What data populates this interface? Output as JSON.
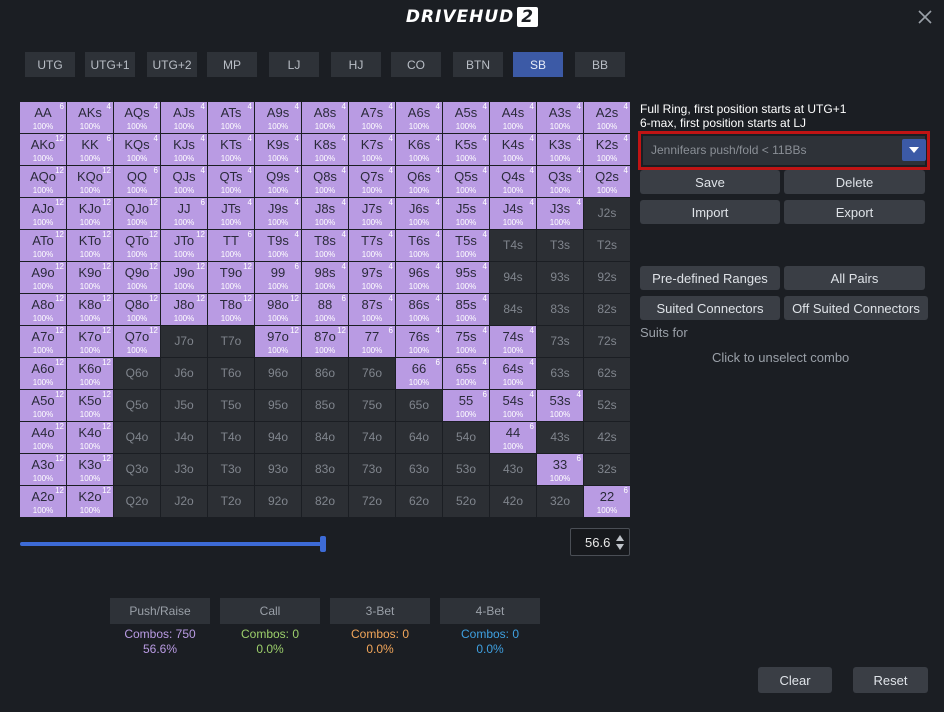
{
  "app": {
    "logo_text": "DRIVEHUD",
    "logo_version": "2"
  },
  "positions": [
    {
      "label": "UTG",
      "active": false
    },
    {
      "label": "UTG+1",
      "active": false
    },
    {
      "label": "UTG+2",
      "active": false
    },
    {
      "label": "MP",
      "active": false
    },
    {
      "label": "LJ",
      "active": false
    },
    {
      "label": "HJ",
      "active": false
    },
    {
      "label": "CO",
      "active": false
    },
    {
      "label": "BTN",
      "active": false
    },
    {
      "label": "SB",
      "active": true
    },
    {
      "label": "BB",
      "active": false
    }
  ],
  "grid": {
    "rows": [
      [
        {
          "h": "AA",
          "s": 1,
          "c": "6",
          "p": "100%"
        },
        {
          "h": "AKs",
          "s": 1,
          "c": "4",
          "p": "100%"
        },
        {
          "h": "AQs",
          "s": 1,
          "c": "4",
          "p": "100%"
        },
        {
          "h": "AJs",
          "s": 1,
          "c": "4",
          "p": "100%"
        },
        {
          "h": "ATs",
          "s": 1,
          "c": "4",
          "p": "100%"
        },
        {
          "h": "A9s",
          "s": 1,
          "c": "4",
          "p": "100%"
        },
        {
          "h": "A8s",
          "s": 1,
          "c": "4",
          "p": "100%"
        },
        {
          "h": "A7s",
          "s": 1,
          "c": "4",
          "p": "100%"
        },
        {
          "h": "A6s",
          "s": 1,
          "c": "4",
          "p": "100%"
        },
        {
          "h": "A5s",
          "s": 1,
          "c": "4",
          "p": "100%"
        },
        {
          "h": "A4s",
          "s": 1,
          "c": "4",
          "p": "100%"
        },
        {
          "h": "A3s",
          "s": 1,
          "c": "4",
          "p": "100%"
        },
        {
          "h": "A2s",
          "s": 1,
          "c": "4",
          "p": "100%"
        }
      ],
      [
        {
          "h": "AKo",
          "s": 1,
          "c": "12",
          "p": "100%"
        },
        {
          "h": "KK",
          "s": 1,
          "c": "6",
          "p": "100%"
        },
        {
          "h": "KQs",
          "s": 1,
          "c": "4",
          "p": "100%"
        },
        {
          "h": "KJs",
          "s": 1,
          "c": "4",
          "p": "100%"
        },
        {
          "h": "KTs",
          "s": 1,
          "c": "4",
          "p": "100%"
        },
        {
          "h": "K9s",
          "s": 1,
          "c": "4",
          "p": "100%"
        },
        {
          "h": "K8s",
          "s": 1,
          "c": "4",
          "p": "100%"
        },
        {
          "h": "K7s",
          "s": 1,
          "c": "4",
          "p": "100%"
        },
        {
          "h": "K6s",
          "s": 1,
          "c": "4",
          "p": "100%"
        },
        {
          "h": "K5s",
          "s": 1,
          "c": "4",
          "p": "100%"
        },
        {
          "h": "K4s",
          "s": 1,
          "c": "4",
          "p": "100%"
        },
        {
          "h": "K3s",
          "s": 1,
          "c": "4",
          "p": "100%"
        },
        {
          "h": "K2s",
          "s": 1,
          "c": "4",
          "p": "100%"
        }
      ],
      [
        {
          "h": "AQo",
          "s": 1,
          "c": "12",
          "p": "100%"
        },
        {
          "h": "KQo",
          "s": 1,
          "c": "12",
          "p": "100%"
        },
        {
          "h": "QQ",
          "s": 1,
          "c": "6",
          "p": "100%"
        },
        {
          "h": "QJs",
          "s": 1,
          "c": "4",
          "p": "100%"
        },
        {
          "h": "QTs",
          "s": 1,
          "c": "4",
          "p": "100%"
        },
        {
          "h": "Q9s",
          "s": 1,
          "c": "4",
          "p": "100%"
        },
        {
          "h": "Q8s",
          "s": 1,
          "c": "4",
          "p": "100%"
        },
        {
          "h": "Q7s",
          "s": 1,
          "c": "4",
          "p": "100%"
        },
        {
          "h": "Q6s",
          "s": 1,
          "c": "4",
          "p": "100%"
        },
        {
          "h": "Q5s",
          "s": 1,
          "c": "4",
          "p": "100%"
        },
        {
          "h": "Q4s",
          "s": 1,
          "c": "4",
          "p": "100%"
        },
        {
          "h": "Q3s",
          "s": 1,
          "c": "4",
          "p": "100%"
        },
        {
          "h": "Q2s",
          "s": 1,
          "c": "4",
          "p": "100%"
        }
      ],
      [
        {
          "h": "AJo",
          "s": 1,
          "c": "12",
          "p": "100%"
        },
        {
          "h": "KJo",
          "s": 1,
          "c": "12",
          "p": "100%"
        },
        {
          "h": "QJo",
          "s": 1,
          "c": "12",
          "p": "100%"
        },
        {
          "h": "JJ",
          "s": 1,
          "c": "6",
          "p": "100%"
        },
        {
          "h": "JTs",
          "s": 1,
          "c": "4",
          "p": "100%"
        },
        {
          "h": "J9s",
          "s": 1,
          "c": "4",
          "p": "100%"
        },
        {
          "h": "J8s",
          "s": 1,
          "c": "4",
          "p": "100%"
        },
        {
          "h": "J7s",
          "s": 1,
          "c": "4",
          "p": "100%"
        },
        {
          "h": "J6s",
          "s": 1,
          "c": "4",
          "p": "100%"
        },
        {
          "h": "J5s",
          "s": 1,
          "c": "4",
          "p": "100%"
        },
        {
          "h": "J4s",
          "s": 1,
          "c": "4",
          "p": "100%"
        },
        {
          "h": "J3s",
          "s": 1,
          "c": "4",
          "p": "100%"
        },
        {
          "h": "J2s",
          "s": 0,
          "c": "",
          "p": ""
        }
      ],
      [
        {
          "h": "ATo",
          "s": 1,
          "c": "12",
          "p": "100%"
        },
        {
          "h": "KTo",
          "s": 1,
          "c": "12",
          "p": "100%"
        },
        {
          "h": "QTo",
          "s": 1,
          "c": "12",
          "p": "100%"
        },
        {
          "h": "JTo",
          "s": 1,
          "c": "12",
          "p": "100%"
        },
        {
          "h": "TT",
          "s": 1,
          "c": "6",
          "p": "100%"
        },
        {
          "h": "T9s",
          "s": 1,
          "c": "4",
          "p": "100%"
        },
        {
          "h": "T8s",
          "s": 1,
          "c": "4",
          "p": "100%"
        },
        {
          "h": "T7s",
          "s": 1,
          "c": "4",
          "p": "100%"
        },
        {
          "h": "T6s",
          "s": 1,
          "c": "4",
          "p": "100%"
        },
        {
          "h": "T5s",
          "s": 1,
          "c": "4",
          "p": "100%"
        },
        {
          "h": "T4s",
          "s": 0,
          "c": "",
          "p": ""
        },
        {
          "h": "T3s",
          "s": 0,
          "c": "",
          "p": ""
        },
        {
          "h": "T2s",
          "s": 0,
          "c": "",
          "p": ""
        }
      ],
      [
        {
          "h": "A9o",
          "s": 1,
          "c": "12",
          "p": "100%"
        },
        {
          "h": "K9o",
          "s": 1,
          "c": "12",
          "p": "100%"
        },
        {
          "h": "Q9o",
          "s": 1,
          "c": "12",
          "p": "100%"
        },
        {
          "h": "J9o",
          "s": 1,
          "c": "12",
          "p": "100%"
        },
        {
          "h": "T9o",
          "s": 1,
          "c": "12",
          "p": "100%"
        },
        {
          "h": "99",
          "s": 1,
          "c": "6",
          "p": "100%"
        },
        {
          "h": "98s",
          "s": 1,
          "c": "4",
          "p": "100%"
        },
        {
          "h": "97s",
          "s": 1,
          "c": "4",
          "p": "100%"
        },
        {
          "h": "96s",
          "s": 1,
          "c": "4",
          "p": "100%"
        },
        {
          "h": "95s",
          "s": 1,
          "c": "4",
          "p": "100%"
        },
        {
          "h": "94s",
          "s": 0,
          "c": "",
          "p": ""
        },
        {
          "h": "93s",
          "s": 0,
          "c": "",
          "p": ""
        },
        {
          "h": "92s",
          "s": 0,
          "c": "",
          "p": ""
        }
      ],
      [
        {
          "h": "A8o",
          "s": 1,
          "c": "12",
          "p": "100%"
        },
        {
          "h": "K8o",
          "s": 1,
          "c": "12",
          "p": "100%"
        },
        {
          "h": "Q8o",
          "s": 1,
          "c": "12",
          "p": "100%"
        },
        {
          "h": "J8o",
          "s": 1,
          "c": "12",
          "p": "100%"
        },
        {
          "h": "T8o",
          "s": 1,
          "c": "12",
          "p": "100%"
        },
        {
          "h": "98o",
          "s": 1,
          "c": "12",
          "p": "100%"
        },
        {
          "h": "88",
          "s": 1,
          "c": "6",
          "p": "100%"
        },
        {
          "h": "87s",
          "s": 1,
          "c": "4",
          "p": "100%"
        },
        {
          "h": "86s",
          "s": 1,
          "c": "4",
          "p": "100%"
        },
        {
          "h": "85s",
          "s": 1,
          "c": "4",
          "p": "100%"
        },
        {
          "h": "84s",
          "s": 0,
          "c": "",
          "p": ""
        },
        {
          "h": "83s",
          "s": 0,
          "c": "",
          "p": ""
        },
        {
          "h": "82s",
          "s": 0,
          "c": "",
          "p": ""
        }
      ],
      [
        {
          "h": "A7o",
          "s": 1,
          "c": "12",
          "p": "100%"
        },
        {
          "h": "K7o",
          "s": 1,
          "c": "12",
          "p": "100%"
        },
        {
          "h": "Q7o",
          "s": 1,
          "c": "12",
          "p": "100%"
        },
        {
          "h": "J7o",
          "s": 0,
          "c": "",
          "p": ""
        },
        {
          "h": "T7o",
          "s": 0,
          "c": "",
          "p": ""
        },
        {
          "h": "97o",
          "s": 1,
          "c": "12",
          "p": "100%"
        },
        {
          "h": "87o",
          "s": 1,
          "c": "12",
          "p": "100%"
        },
        {
          "h": "77",
          "s": 1,
          "c": "6",
          "p": "100%"
        },
        {
          "h": "76s",
          "s": 1,
          "c": "4",
          "p": "100%"
        },
        {
          "h": "75s",
          "s": 1,
          "c": "4",
          "p": "100%"
        },
        {
          "h": "74s",
          "s": 1,
          "c": "4",
          "p": "100%"
        },
        {
          "h": "73s",
          "s": 0,
          "c": "",
          "p": ""
        },
        {
          "h": "72s",
          "s": 0,
          "c": "",
          "p": ""
        }
      ],
      [
        {
          "h": "A6o",
          "s": 1,
          "c": "12",
          "p": "100%"
        },
        {
          "h": "K6o",
          "s": 1,
          "c": "12",
          "p": "100%"
        },
        {
          "h": "Q6o",
          "s": 0,
          "c": "",
          "p": ""
        },
        {
          "h": "J6o",
          "s": 0,
          "c": "",
          "p": ""
        },
        {
          "h": "T6o",
          "s": 0,
          "c": "",
          "p": ""
        },
        {
          "h": "96o",
          "s": 0,
          "c": "",
          "p": ""
        },
        {
          "h": "86o",
          "s": 0,
          "c": "",
          "p": ""
        },
        {
          "h": "76o",
          "s": 0,
          "c": "",
          "p": ""
        },
        {
          "h": "66",
          "s": 1,
          "c": "6",
          "p": "100%"
        },
        {
          "h": "65s",
          "s": 1,
          "c": "4",
          "p": "100%"
        },
        {
          "h": "64s",
          "s": 1,
          "c": "4",
          "p": "100%"
        },
        {
          "h": "63s",
          "s": 0,
          "c": "",
          "p": ""
        },
        {
          "h": "62s",
          "s": 0,
          "c": "",
          "p": ""
        }
      ],
      [
        {
          "h": "A5o",
          "s": 1,
          "c": "12",
          "p": "100%"
        },
        {
          "h": "K5o",
          "s": 1,
          "c": "12",
          "p": "100%"
        },
        {
          "h": "Q5o",
          "s": 0,
          "c": "",
          "p": ""
        },
        {
          "h": "J5o",
          "s": 0,
          "c": "",
          "p": ""
        },
        {
          "h": "T5o",
          "s": 0,
          "c": "",
          "p": ""
        },
        {
          "h": "95o",
          "s": 0,
          "c": "",
          "p": ""
        },
        {
          "h": "85o",
          "s": 0,
          "c": "",
          "p": ""
        },
        {
          "h": "75o",
          "s": 0,
          "c": "",
          "p": ""
        },
        {
          "h": "65o",
          "s": 0,
          "c": "",
          "p": ""
        },
        {
          "h": "55",
          "s": 1,
          "c": "6",
          "p": "100%"
        },
        {
          "h": "54s",
          "s": 1,
          "c": "4",
          "p": "100%"
        },
        {
          "h": "53s",
          "s": 1,
          "c": "4",
          "p": "100%"
        },
        {
          "h": "52s",
          "s": 0,
          "c": "",
          "p": ""
        }
      ],
      [
        {
          "h": "A4o",
          "s": 1,
          "c": "12",
          "p": "100%"
        },
        {
          "h": "K4o",
          "s": 1,
          "c": "12",
          "p": "100%"
        },
        {
          "h": "Q4o",
          "s": 0,
          "c": "",
          "p": ""
        },
        {
          "h": "J4o",
          "s": 0,
          "c": "",
          "p": ""
        },
        {
          "h": "T4o",
          "s": 0,
          "c": "",
          "p": ""
        },
        {
          "h": "94o",
          "s": 0,
          "c": "",
          "p": ""
        },
        {
          "h": "84o",
          "s": 0,
          "c": "",
          "p": ""
        },
        {
          "h": "74o",
          "s": 0,
          "c": "",
          "p": ""
        },
        {
          "h": "64o",
          "s": 0,
          "c": "",
          "p": ""
        },
        {
          "h": "54o",
          "s": 0,
          "c": "",
          "p": ""
        },
        {
          "h": "44",
          "s": 1,
          "c": "6",
          "p": "100%"
        },
        {
          "h": "43s",
          "s": 0,
          "c": "",
          "p": ""
        },
        {
          "h": "42s",
          "s": 0,
          "c": "",
          "p": ""
        }
      ],
      [
        {
          "h": "A3o",
          "s": 1,
          "c": "12",
          "p": "100%"
        },
        {
          "h": "K3o",
          "s": 1,
          "c": "12",
          "p": "100%"
        },
        {
          "h": "Q3o",
          "s": 0,
          "c": "",
          "p": ""
        },
        {
          "h": "J3o",
          "s": 0,
          "c": "",
          "p": ""
        },
        {
          "h": "T3o",
          "s": 0,
          "c": "",
          "p": ""
        },
        {
          "h": "93o",
          "s": 0,
          "c": "",
          "p": ""
        },
        {
          "h": "83o",
          "s": 0,
          "c": "",
          "p": ""
        },
        {
          "h": "73o",
          "s": 0,
          "c": "",
          "p": ""
        },
        {
          "h": "63o",
          "s": 0,
          "c": "",
          "p": ""
        },
        {
          "h": "53o",
          "s": 0,
          "c": "",
          "p": ""
        },
        {
          "h": "43o",
          "s": 0,
          "c": "",
          "p": ""
        },
        {
          "h": "33",
          "s": 1,
          "c": "6",
          "p": "100%"
        },
        {
          "h": "32s",
          "s": 0,
          "c": "",
          "p": ""
        }
      ],
      [
        {
          "h": "A2o",
          "s": 1,
          "c": "12",
          "p": "100%"
        },
        {
          "h": "K2o",
          "s": 1,
          "c": "12",
          "p": "100%"
        },
        {
          "h": "Q2o",
          "s": 0,
          "c": "",
          "p": ""
        },
        {
          "h": "J2o",
          "s": 0,
          "c": "",
          "p": ""
        },
        {
          "h": "T2o",
          "s": 0,
          "c": "",
          "p": ""
        },
        {
          "h": "92o",
          "s": 0,
          "c": "",
          "p": ""
        },
        {
          "h": "82o",
          "s": 0,
          "c": "",
          "p": ""
        },
        {
          "h": "72o",
          "s": 0,
          "c": "",
          "p": ""
        },
        {
          "h": "62o",
          "s": 0,
          "c": "",
          "p": ""
        },
        {
          "h": "52o",
          "s": 0,
          "c": "",
          "p": ""
        },
        {
          "h": "42o",
          "s": 0,
          "c": "",
          "p": ""
        },
        {
          "h": "32o",
          "s": 0,
          "c": "",
          "p": ""
        },
        {
          "h": "22",
          "s": 1,
          "c": "6",
          "p": "100%"
        }
      ]
    ]
  },
  "slider": {
    "value": 56.6,
    "min": 0,
    "max": 100,
    "display": "56.6"
  },
  "actions": [
    {
      "label": "Push/Raise",
      "combos": "Combos: 750",
      "percent": "56.6%",
      "color": "#b99be3"
    },
    {
      "label": "Call",
      "combos": "Combos: 0",
      "percent": "0.0%",
      "color": "#9ccf6b"
    },
    {
      "label": "3-Bet",
      "combos": "Combos: 0",
      "percent": "0.0%",
      "color": "#f2a65a"
    },
    {
      "label": "4-Bet",
      "combos": "Combos: 0",
      "percent": "0.0%",
      "color": "#3fa0e0"
    }
  ],
  "info": {
    "line1": "Full Ring, first position starts at UTG+1",
    "line2": "6-max, first position starts at LJ"
  },
  "range_select": {
    "value": "Jennifears push/fold < 11BBs"
  },
  "buttons": {
    "save": "Save",
    "delete": "Delete",
    "import": "Import",
    "export": "Export",
    "predefined": "Pre-defined Ranges",
    "all_pairs": "All Pairs",
    "suited_connectors": "Suited Connectors",
    "off_suited_connectors": "Off Suited Connectors",
    "clear": "Clear",
    "reset": "Reset"
  },
  "suits_label": "Suits for",
  "unselect_hint": "Click to unselect combo",
  "colors": {
    "selected": "#b99be3",
    "unselected": "#2c2f34",
    "accent": "#3c5aa6",
    "highlight": "#c01414"
  }
}
